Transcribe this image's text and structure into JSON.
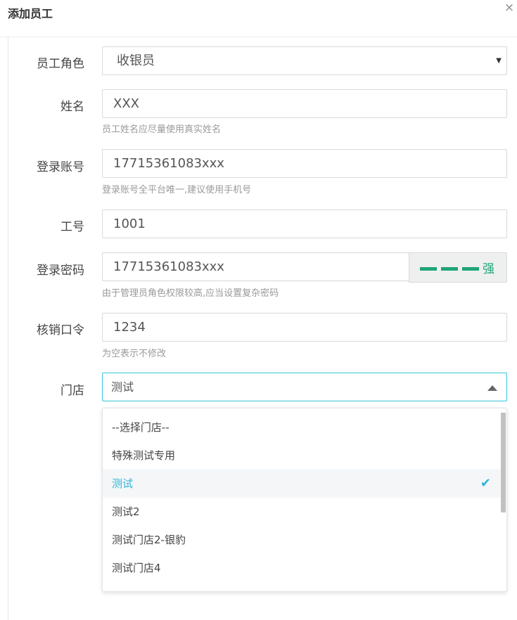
{
  "dialog": {
    "title": "添加员工",
    "close_icon": "×"
  },
  "form": {
    "role": {
      "label": "员工角色",
      "value": "收银员",
      "caret": "▼"
    },
    "name": {
      "label": "姓名",
      "value": "XXX",
      "help": "员工姓名应尽量使用真实姓名"
    },
    "account": {
      "label": "登录账号",
      "value": "17715361083xxx",
      "help": "登录账号全平台唯一,建议使用手机号"
    },
    "employee_no": {
      "label": "工号",
      "value": "1001"
    },
    "password": {
      "label": "登录密码",
      "value": "17715361083xxx",
      "strength_label": "强",
      "strength_level": 3,
      "help": "由于管理员角色权限较高,应当设置复杂密码"
    },
    "verify_code": {
      "label": "核销口令",
      "value": "1234",
      "help": "为空表示不修改"
    },
    "store": {
      "label": "门店",
      "value": "测试",
      "options": [
        "--选择门店--",
        "特殊测试专用",
        "测试",
        "测试2",
        "测试门店2-银豹",
        "测试门店4"
      ],
      "selected_index": 2,
      "check_icon": "✔"
    }
  },
  "colors": {
    "accent": "#2cb7d9",
    "strength": "#1fa577"
  }
}
